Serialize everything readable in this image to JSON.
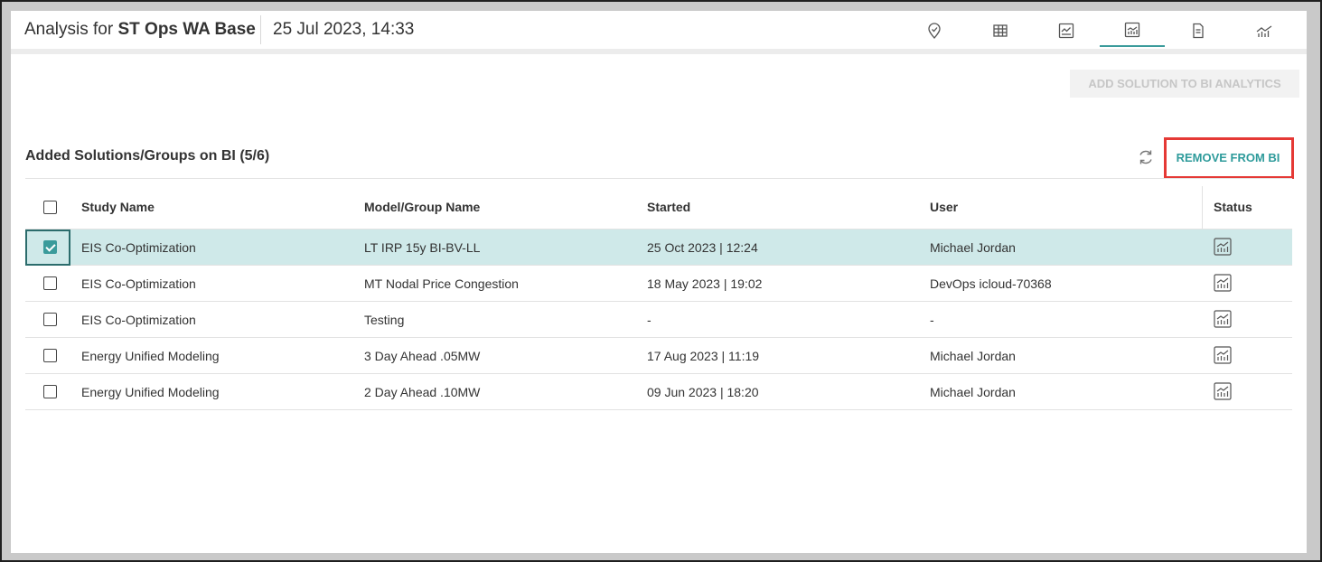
{
  "header": {
    "title_prefix": "Analysis for ",
    "title_name": "ST Ops WA Base",
    "date": "25 Jul 2023, 14:33",
    "nav_icons": [
      "location-pin-icon",
      "table-icon",
      "chart-edit-icon",
      "bi-chart-icon",
      "document-icon",
      "line-chart-icon"
    ],
    "active_nav": "bi-chart-icon"
  },
  "toolbar": {
    "add_label": "ADD SOLUTION TO BI ANALYTICS",
    "remove_label": "REMOVE FROM BI"
  },
  "section": {
    "title": "Added Solutions/Groups on BI (5/6)"
  },
  "table": {
    "columns": [
      "Study Name",
      "Model/Group Name",
      "Started",
      "User",
      "Status"
    ],
    "rows": [
      {
        "study": "EIS Co-Optimization",
        "model": "LT IRP 15y BI-BV-LL",
        "started": "25 Oct 2023 | 12:24",
        "user": "Michael Jordan",
        "checked": true
      },
      {
        "study": "EIS Co-Optimization",
        "model": "MT Nodal Price Congestion",
        "started": "18 May 2023 | 19:02",
        "user": "DevOps icloud-70368",
        "checked": false
      },
      {
        "study": "EIS Co-Optimization",
        "model": "Testing",
        "started": "-",
        "user": "-",
        "checked": false
      },
      {
        "study": "Energy Unified Modeling",
        "model": "3 Day Ahead .05MW",
        "started": "17 Aug 2023 | 11:19",
        "user": "Michael Jordan",
        "checked": false
      },
      {
        "study": "Energy Unified Modeling",
        "model": "2 Day Ahead .10MW",
        "started": "09 Jun 2023 | 18:20",
        "user": "Michael Jordan",
        "checked": false
      }
    ]
  },
  "colors": {
    "accent": "#3a9b9b",
    "selected_row": "#cfe9e9",
    "highlight_box": "#e53935",
    "disabled_text": "#c6c6c6"
  }
}
